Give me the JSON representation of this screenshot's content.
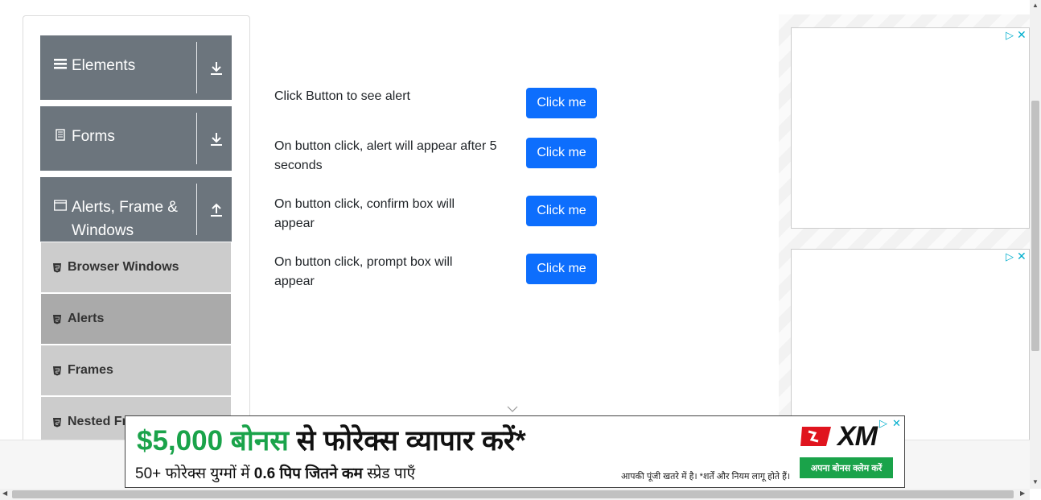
{
  "sidebar": {
    "groups": [
      {
        "title": "Elements",
        "icon": "hamburger-icon",
        "arrow": "download-arrow-icon"
      },
      {
        "title": "Forms",
        "icon": "document-icon",
        "arrow": "download-arrow-icon"
      },
      {
        "title": "Alerts, Frame & Windows",
        "icon": "window-icon",
        "arrow": "upload-arrow-icon"
      }
    ],
    "items": [
      {
        "label": "Browser Windows",
        "active": false
      },
      {
        "label": "Alerts",
        "active": true
      },
      {
        "label": "Frames",
        "active": false
      },
      {
        "label": "Nested Frames",
        "active": false
      }
    ]
  },
  "main": {
    "rows": [
      {
        "text": "Click Button to see alert",
        "button": "Click me"
      },
      {
        "text": "On button click, alert will appear after 5 seconds",
        "button": "Click me"
      },
      {
        "text": "On button click, confirm box will appear",
        "button": "Click me"
      },
      {
        "text": "On button click, prompt box will appear",
        "button": "Click me"
      }
    ]
  },
  "banner_ad": {
    "headline_amount": "$5,000 बोनस",
    "headline_rest": "से फोरेक्स व्यापार करें*",
    "sub_pre": "50+ फोरेक्स युग्मों में",
    "sub_bold": "0.6 पिप जितने कम",
    "sub_post": "स्प्रेड पाएँ",
    "disclaimer": "आपकी पूंजी खतरे में है। *शर्तें और नियम लागू होते हैं।",
    "brand": "XM",
    "cta": "अपना बोनस क्लेम करें"
  },
  "colors": {
    "primary_button": "#0d6efd",
    "sidebar_header": "#6c757d",
    "menu_item": "#cccccc",
    "menu_item_active": "#aaaaaa",
    "ad_green": "#1aa34a"
  }
}
